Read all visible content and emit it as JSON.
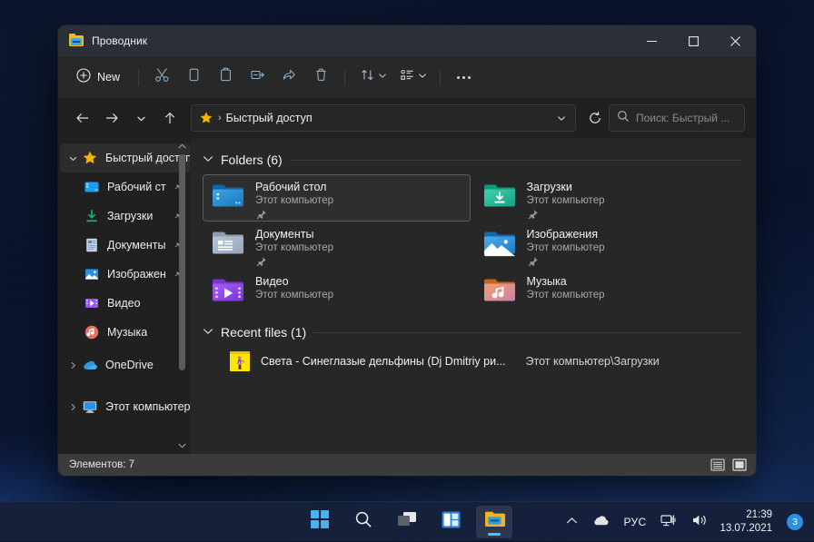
{
  "window": {
    "title": "Проводник",
    "icon": "folder-explorer-icon",
    "controls": {
      "minimize": "minimize-icon",
      "maximize": "maximize-icon",
      "close": "close-icon"
    }
  },
  "commandbar": {
    "new_label": "New",
    "items": [
      {
        "name": "new-button",
        "label": "New",
        "icon": "plus-circle-icon"
      },
      {
        "name": "cut-button",
        "label": "Cut",
        "icon": "scissors-icon"
      },
      {
        "name": "copy-button",
        "label": "Copy",
        "icon": "copy-icon"
      },
      {
        "name": "paste-button",
        "label": "Paste",
        "icon": "clipboard-icon"
      },
      {
        "name": "rename-button",
        "label": "Rename",
        "icon": "rename-icon"
      },
      {
        "name": "share-button",
        "label": "Share",
        "icon": "share-icon"
      },
      {
        "name": "delete-button",
        "label": "Delete",
        "icon": "trash-icon"
      },
      {
        "name": "sort-button",
        "label": "Sort",
        "icon": "sort-icon"
      },
      {
        "name": "view-button",
        "label": "View",
        "icon": "view-list-icon"
      },
      {
        "name": "more-button",
        "label": "See more",
        "icon": "ellipsis-icon"
      }
    ]
  },
  "address": {
    "breadcrumb_icon": "star-icon",
    "separator": "›",
    "crumb": "Быстрый доступ",
    "dropdown_icon": "chevron-down-icon",
    "refresh_icon": "refresh-icon",
    "back_icon": "arrow-left-icon",
    "forward_icon": "arrow-right-icon",
    "recent_icon": "chevron-down-icon",
    "up_icon": "arrow-up-icon"
  },
  "search": {
    "icon": "search-icon",
    "placeholder": "Поиск: Быстрый ..."
  },
  "sidebar": {
    "items": [
      {
        "label": "Быстрый доступ",
        "icon": "star-icon",
        "level": 0,
        "chevron": "expanded",
        "selected": true,
        "pinned": false
      },
      {
        "label": "Рабочий ст",
        "icon": "desktop-icon",
        "level": 1,
        "chevron": "none",
        "selected": false,
        "pinned": true
      },
      {
        "label": "Загрузки",
        "icon": "downloads-icon",
        "level": 1,
        "chevron": "none",
        "selected": false,
        "pinned": true
      },
      {
        "label": "Документы",
        "icon": "documents-icon",
        "level": 1,
        "chevron": "none",
        "selected": false,
        "pinned": true
      },
      {
        "label": "Изображен",
        "icon": "pictures-icon",
        "level": 1,
        "chevron": "none",
        "selected": false,
        "pinned": true
      },
      {
        "label": "Видео",
        "icon": "videos-icon",
        "level": 1,
        "chevron": "none",
        "selected": false,
        "pinned": false
      },
      {
        "label": "Музыка",
        "icon": "music-icon",
        "level": 1,
        "chevron": "none",
        "selected": false,
        "pinned": false
      },
      {
        "label": "OneDrive",
        "icon": "onedrive-icon",
        "level": 0,
        "chevron": "collapsed",
        "selected": false,
        "pinned": false
      },
      {
        "label": "Этот компьютер",
        "icon": "thispc-icon",
        "level": 0,
        "chevron": "collapsed",
        "selected": false,
        "pinned": false
      }
    ]
  },
  "content": {
    "folders_group": {
      "title": "Folders (6)",
      "chevron": "expanded"
    },
    "folders": [
      {
        "name": "Рабочий стол",
        "location": "Этот компьютер",
        "icon": "desktop-folder-icon",
        "pinned": true,
        "selected": true
      },
      {
        "name": "Загрузки",
        "location": "Этот компьютер",
        "icon": "downloads-folder-icon",
        "pinned": true,
        "selected": false
      },
      {
        "name": "Документы",
        "location": "Этот компьютер",
        "icon": "documents-folder-icon",
        "pinned": true,
        "selected": false
      },
      {
        "name": "Изображения",
        "location": "Этот компьютер",
        "icon": "pictures-folder-icon",
        "pinned": true,
        "selected": false
      },
      {
        "name": "Видео",
        "location": "Этот компьютер",
        "icon": "videos-folder-icon",
        "pinned": false,
        "selected": false
      },
      {
        "name": "Музыка",
        "location": "Этот компьютер",
        "icon": "music-folder-icon",
        "pinned": false,
        "selected": false
      }
    ],
    "recent_group": {
      "title": "Recent files (1)",
      "chevron": "expanded"
    },
    "recent_files": [
      {
        "name": "Света - Синеглазые дельфины (Dj Dmitriy ри...",
        "path": "Этот компьютер\\Загрузки",
        "icon": "audio-thumbnail-icon"
      }
    ]
  },
  "status": {
    "items_text": "Элементов: 7",
    "view_details": "details-view-icon",
    "view_large": "large-icons-view-icon"
  },
  "taskbar": {
    "buttons": [
      {
        "name": "start-button",
        "icon": "windows-logo-icon"
      },
      {
        "name": "search-button",
        "icon": "search-icon"
      },
      {
        "name": "task-view-button",
        "icon": "task-view-icon"
      },
      {
        "name": "widgets-button",
        "icon": "widgets-icon"
      },
      {
        "name": "file-explorer-button",
        "icon": "folder-explorer-icon"
      }
    ],
    "tray": {
      "overflow_icon": "chevron-up-icon",
      "onedrive_icon": "cloud-icon",
      "language": "РУС",
      "network_icon": "network-icon",
      "volume_icon": "speaker-icon",
      "time": "21:39",
      "date": "13.07.2021",
      "notification_count": "3"
    }
  },
  "colors": {
    "accent": "#4cc2ff",
    "window_bg": "#202020",
    "content_bg": "#272727",
    "titlebar_bg": "#2b2f38",
    "status_bg": "#3b3b3b",
    "star_gold": "#f5b400"
  }
}
